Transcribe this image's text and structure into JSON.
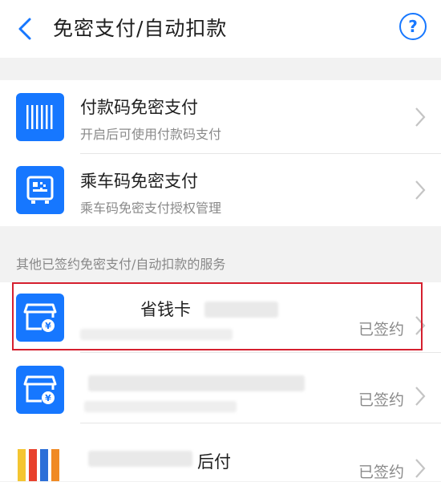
{
  "header": {
    "title": "免密支付/自动扣款",
    "help_icon": "help-circle-icon",
    "help_glyph": "?"
  },
  "auth_group": {
    "items": [
      {
        "title": "付款码免密支付",
        "subtitle": "开启后可使用付款码支付",
        "icon": "barcode-icon"
      },
      {
        "title": "乘车码免密支付",
        "subtitle": "乘车码免密支付授权管理",
        "icon": "bus-code-icon"
      }
    ]
  },
  "other_section": {
    "label": "其他已签约免密支付/自动扣款的服务",
    "services": [
      {
        "title": "省钱卡",
        "subtitle": "",
        "status": "已签约",
        "icon": "store-yen-icon",
        "highlighted": true
      },
      {
        "title": "",
        "subtitle": "",
        "status": "已签约",
        "icon": "store-yen-icon",
        "highlighted": false
      },
      {
        "title": "后付",
        "subtitle": "",
        "status": "已签约",
        "icon": "colorful-bars-icon",
        "highlighted": false
      }
    ]
  },
  "colors": {
    "accent": "#1677ff",
    "highlight": "#d5202f"
  }
}
